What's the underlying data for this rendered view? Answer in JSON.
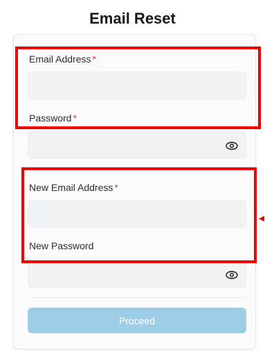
{
  "title": "Email Reset",
  "form": {
    "email_label": "Email Address",
    "password_label": "Password",
    "new_email_label": "New Email Address",
    "new_password_label": "New Password",
    "required_mark": "*",
    "proceed_label": "Proceed"
  },
  "icons": {
    "password_toggle": "eye-icon",
    "new_password_toggle": "eye-icon"
  },
  "colors": {
    "highlight": "#ee0000",
    "required": "#e0373d",
    "proceed_bg": "#9ecde8"
  }
}
